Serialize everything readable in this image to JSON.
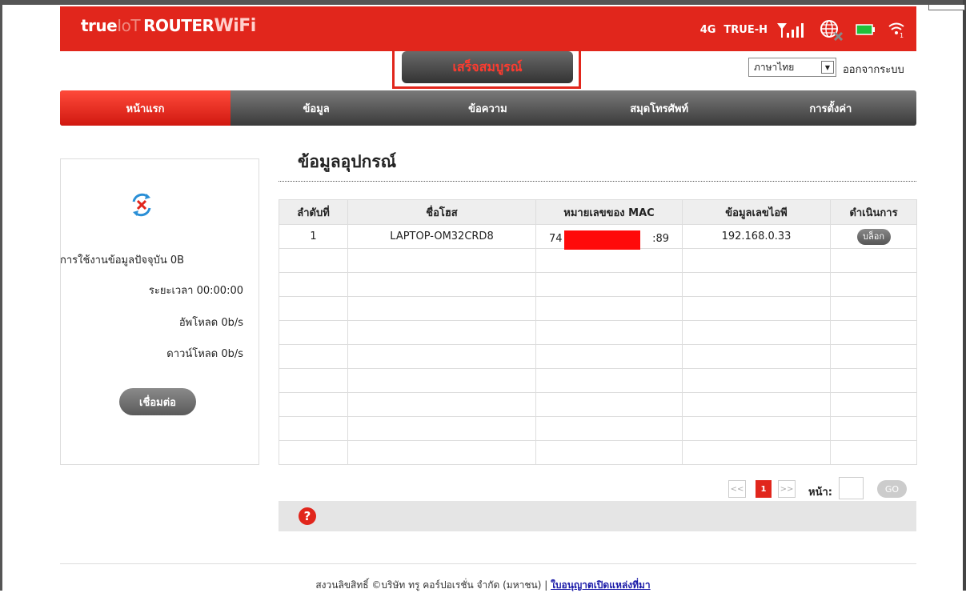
{
  "header": {
    "logo_true": "true",
    "logo_iot": "IoT",
    "logo_router": "ROUTER",
    "logo_wifi": "WiFi",
    "network_type": "4G",
    "carrier": "TRUE-H",
    "icons": [
      "signal-icon",
      "globe-disconnected-icon",
      "battery-icon",
      "wifi-clients-icon"
    ],
    "wifi_clients": "1"
  },
  "status_button": "เสร็จสมบูรณ์",
  "language": {
    "selected": "ภาษาไทย"
  },
  "logout": "ออกจากระบบ",
  "nav": [
    {
      "label": "หน้าแรก",
      "active": true
    },
    {
      "label": "ข้อมูล"
    },
    {
      "label": "ข้อความ"
    },
    {
      "label": "สมุดโทรศัพท์"
    },
    {
      "label": "การตั้งค่า"
    }
  ],
  "sidebar": {
    "usage": "การใช้งานข้อมูลปัจจุบัน 0B",
    "duration": "ระยะเวลา 00:00:00",
    "upload": "อัพโหลด 0b/s",
    "download": "ดาวน์โหลด 0b/s",
    "connect_button": "เชื่อมต่อ"
  },
  "section_title": "ข้อมูลอุปกรณ์",
  "table": {
    "headers": [
      "ลำดับที่",
      "ชื่อโฮส",
      "หมายเลขของ MAC",
      "ข้อมูลเลขไอพี",
      "ดำเนินการ"
    ],
    "row": {
      "index": "1",
      "host": "LAPTOP-OM32CRD8",
      "mac_start": "74",
      "mac_end": ":89",
      "ip": "192.168.0.33",
      "action": "บล็อก"
    }
  },
  "pager": {
    "prev": "<<",
    "current": "1",
    "next": ">>",
    "page_label": "หน้า:",
    "go": "GO"
  },
  "help": "?",
  "footer": {
    "copyright": "สงวนลิขสิทธิ์ ©บริษัท ทรู คอร์ปอเรชั่น จำกัด (มหาชน)  |  ",
    "link": "ใบอนุญาตเปิดแหล่งที่มา"
  }
}
